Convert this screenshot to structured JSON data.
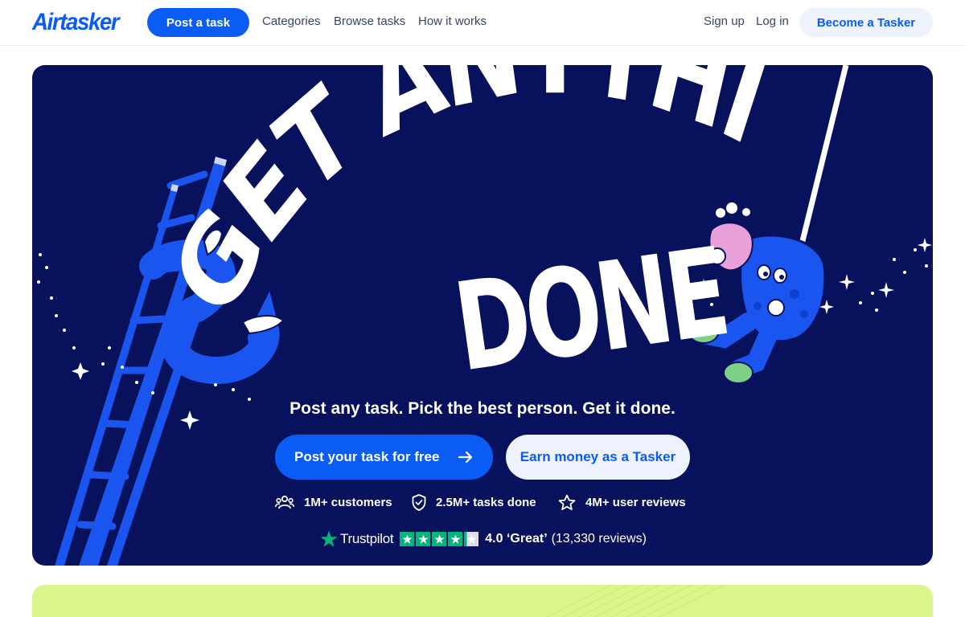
{
  "header": {
    "logo_text": "Airtasker",
    "post_task_label": "Post a task",
    "nav": [
      "Categories",
      "Browse tasks",
      "How it works"
    ],
    "sign_up_label": "Sign up",
    "log_in_label": "Log in",
    "become_tasker_label": "Become a Tasker"
  },
  "hero": {
    "headline_line1": "GET ANYTHING",
    "headline_line2": "DONE",
    "subheadline": "Post any task. Pick the best person. Get it done.",
    "cta_primary": "Post your task for free",
    "cta_secondary": "Earn money as a Tasker",
    "stats": [
      {
        "icon": "people-icon",
        "label": "1M+ customers"
      },
      {
        "icon": "shield-check-icon",
        "label": "2.5M+ tasks done"
      },
      {
        "icon": "star-outline-icon",
        "label": "4M+ user reviews"
      }
    ],
    "trustpilot": {
      "brand": "Trustpilot",
      "stars": 4.2,
      "score": "4.0 ‘Great’",
      "reviews": "(13,330 reviews)"
    }
  },
  "colors": {
    "brand_blue": "#0a5cf5",
    "hero_navy": "#08125c",
    "tasker_button_bg": "#eef2fd",
    "trustpilot_green": "#00b67a",
    "band_lime": "#dcf58a"
  }
}
